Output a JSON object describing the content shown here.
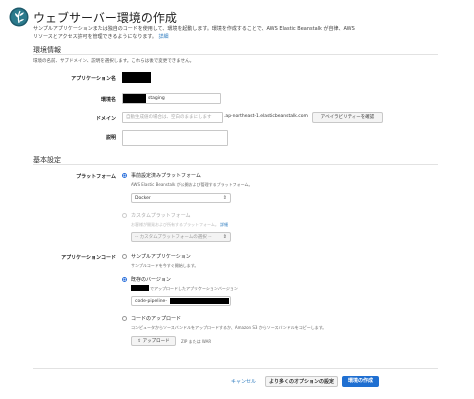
{
  "header": {
    "title": "ウェブサーバー環境の作成",
    "intro_line1": "サンプルアプリケーションまたは独自のコードを使用して、環境を起動します。環境を作成することで、AWS Elastic Beanstalk が自律、AWS",
    "intro_line2": "リソースとアクセス許可を管理できるようになります。",
    "intro_link": "詳細"
  },
  "env_info": {
    "section_title": "環境情報",
    "section_note": "環境の名前、サブドメイン、説明を選択します。これらは後で変更できません。",
    "app_name_label": "アプリケーション名",
    "env_name_label": "環境名",
    "env_name_value": "staging",
    "domain_label": "ドメイン",
    "domain_placeholder": "自動生成値の場合は、空白のままにします",
    "domain_suffix": ".ap-northeast-1.elasticbeanstalk.com",
    "check_availability_button": "アベイラビリティーを確認",
    "description_label": "説明"
  },
  "base_config": {
    "section_title": "基本設定",
    "platform_label": "プラットフォーム",
    "platform_managed_label": "事前設定済みプラットフォーム",
    "platform_managed_help": "AWS Elastic Beanstalk が公開および管理するプラットフォーム。",
    "platform_select_value": "Docker",
    "platform_custom_label": "カスタムプラットフォーム",
    "platform_custom_help": "お客様が開発および所有するプラットフォーム。",
    "platform_custom_help_link": "詳細",
    "platform_custom_select": "-- カスタムプラットフォームの選択 --",
    "app_code_label": "アプリケーションコード",
    "sample_app_label": "サンプルアプリケーション",
    "sample_app_help": "サンプルコードを今すぐ開始します。",
    "existing_version_label": "既存のバージョン",
    "existing_version_help": "でアップロードしたアプリケーションバージョン",
    "existing_version_value": "code-pipeline-",
    "upload_label": "コードのアップロード",
    "upload_help": "コンピュータからソースバンドルをアップロードするか、Amazon S3 からソースバンドルをコピーします。",
    "upload_button": "アップロード",
    "upload_note": "ZIP または WAR"
  },
  "footer": {
    "cancel": "キャンセル",
    "more_options": "より多くのオプションの設定",
    "create": "環境の作成"
  },
  "colors": {
    "primary": "#1f6fd1",
    "link": "#2d7bbf",
    "radio_selected": "#2a6fdb"
  }
}
